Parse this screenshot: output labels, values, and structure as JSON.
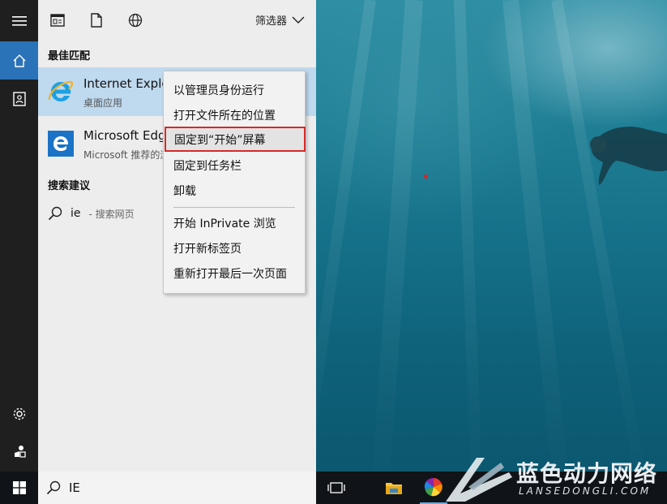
{
  "filter": {
    "label": "筛选器"
  },
  "sections": {
    "best_match": "最佳匹配",
    "suggestions": "搜索建议"
  },
  "results": [
    {
      "name": "Internet Explorer",
      "sub": "桌面应用",
      "icon": "internet-explorer-icon"
    },
    {
      "name": "Microsoft Edge",
      "sub": "Microsoft 推荐的浏览器",
      "icon": "microsoft-edge-icon"
    }
  ],
  "suggestion": {
    "query": "ie",
    "hint": "- 搜索网页"
  },
  "context_menu": {
    "items": [
      "以管理员身份运行",
      "打开文件所在的位置",
      "固定到“开始”屏幕",
      "固定到任务栏",
      "卸载",
      "开始 InPrivate 浏览",
      "打开新标签页",
      "重新打开最后一次页面"
    ],
    "highlighted_index": 2,
    "highlight_color": "#d42a2a"
  },
  "search": {
    "value": "IE"
  },
  "watermark": {
    "cn": "蓝色动力网络",
    "en": "LANSEDONGLI.COM"
  },
  "colors": {
    "accent": "#2a73b8",
    "selected": "#bfd9ee",
    "rail": "#1f1f1f"
  }
}
